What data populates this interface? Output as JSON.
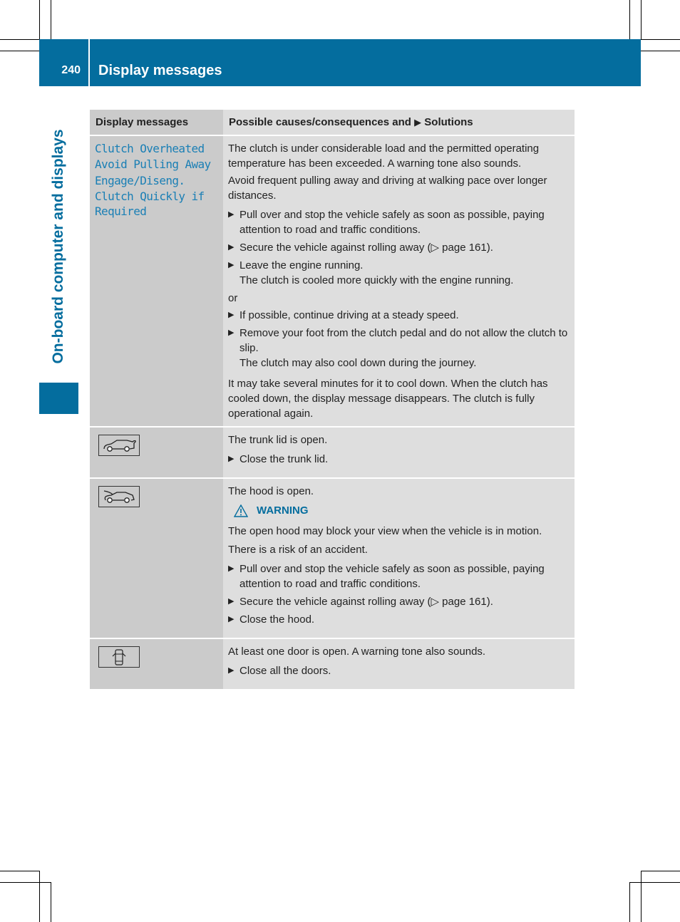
{
  "header": {
    "page_number": "240",
    "section_title": "Display messages",
    "side_label": "On-board computer and displays"
  },
  "table": {
    "columns": [
      "Display messages",
      "Possible causes/consequences and",
      "Solutions"
    ],
    "rows": [
      {
        "message_lines": [
          "Clutch Overheated\nAvoid Pulling Away",
          "Engage/Diseng.\nClutch Quickly if\nRequired"
        ],
        "paragraphs": [
          "The clutch is under considerable load and the permitted operating temperature has been exceeded. A warning tone also sounds.",
          "Avoid frequent pulling away and driving at walking pace over longer distances."
        ],
        "steps": [
          {
            "text": "Pull over and stop the vehicle safely as soon as possible, paying attention to road and traffic conditions."
          },
          {
            "text": "Secure the vehicle against rolling away (▷ page 161)."
          },
          {
            "text": "Leave the engine running.",
            "note": "The clutch is cooled more quickly with the engine running."
          }
        ],
        "or_label": "or",
        "steps2": [
          {
            "text": "If possible, continue driving at a steady speed."
          },
          {
            "text": "Remove your foot from the clutch pedal and do not allow the clutch to slip.",
            "note": "The clutch may also cool down during the journey."
          }
        ],
        "closing": "It may take several minutes for it to cool down. When the clutch has cooled down, the display message disappears. The clutch is fully operational again."
      },
      {
        "icon": "trunk-open-icon",
        "paragraphs": [
          "The trunk lid is open."
        ],
        "steps": [
          {
            "text": "Close the trunk lid."
          }
        ]
      },
      {
        "icon": "hood-open-icon",
        "paragraphs": [
          "The hood is open."
        ],
        "warning": {
          "label": "WARNING",
          "lines": [
            "The open hood may block your view when the vehicle is in motion.",
            "There is a risk of an accident."
          ]
        },
        "steps": [
          {
            "text": "Pull over and stop the vehicle safely as soon as possible, paying attention to road and traffic conditions."
          },
          {
            "text": "Secure the vehicle against rolling away (▷ page 161)."
          },
          {
            "text": "Close the hood."
          }
        ]
      },
      {
        "icon": "door-open-icon",
        "paragraphs": [
          "At least one door is open. A warning tone also sounds."
        ],
        "steps": [
          {
            "text": "Close all the doors."
          }
        ]
      }
    ]
  },
  "colors": {
    "brand_blue": "#046d9e",
    "message_text": "#1a7fb5",
    "col1_bg": "#cbcbcb",
    "col2_bg": "#dedede"
  }
}
